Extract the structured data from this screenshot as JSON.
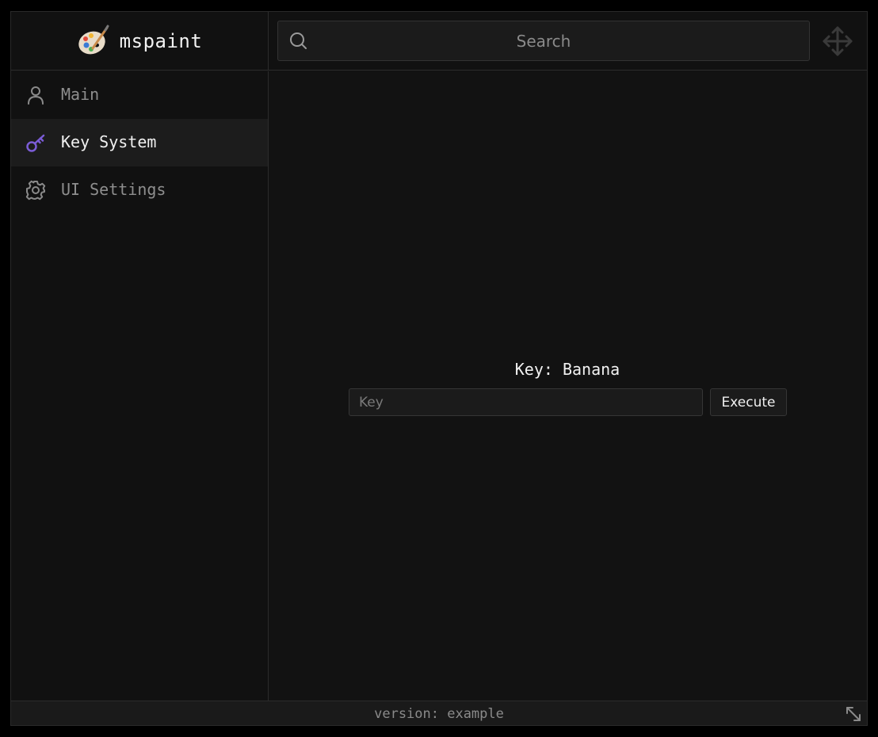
{
  "app": {
    "title": "mspaint",
    "logo_icon": "paint-palette-icon"
  },
  "search": {
    "placeholder": "Search",
    "value": ""
  },
  "sidebar": {
    "items": [
      {
        "label": "Main",
        "icon": "user-icon",
        "active": false
      },
      {
        "label": "Key System",
        "icon": "key-icon",
        "active": true
      },
      {
        "label": "UI Settings",
        "icon": "gear-icon",
        "active": false
      }
    ]
  },
  "key_system": {
    "key_label": "Key: Banana",
    "input_placeholder": "Key",
    "input_value": "",
    "execute_label": "Execute"
  },
  "footer": {
    "version_text": "version: example"
  },
  "colors": {
    "accent": "#7b5cd6",
    "background": "#121212",
    "panel": "#111111",
    "active_item": "#1c1c1c"
  }
}
